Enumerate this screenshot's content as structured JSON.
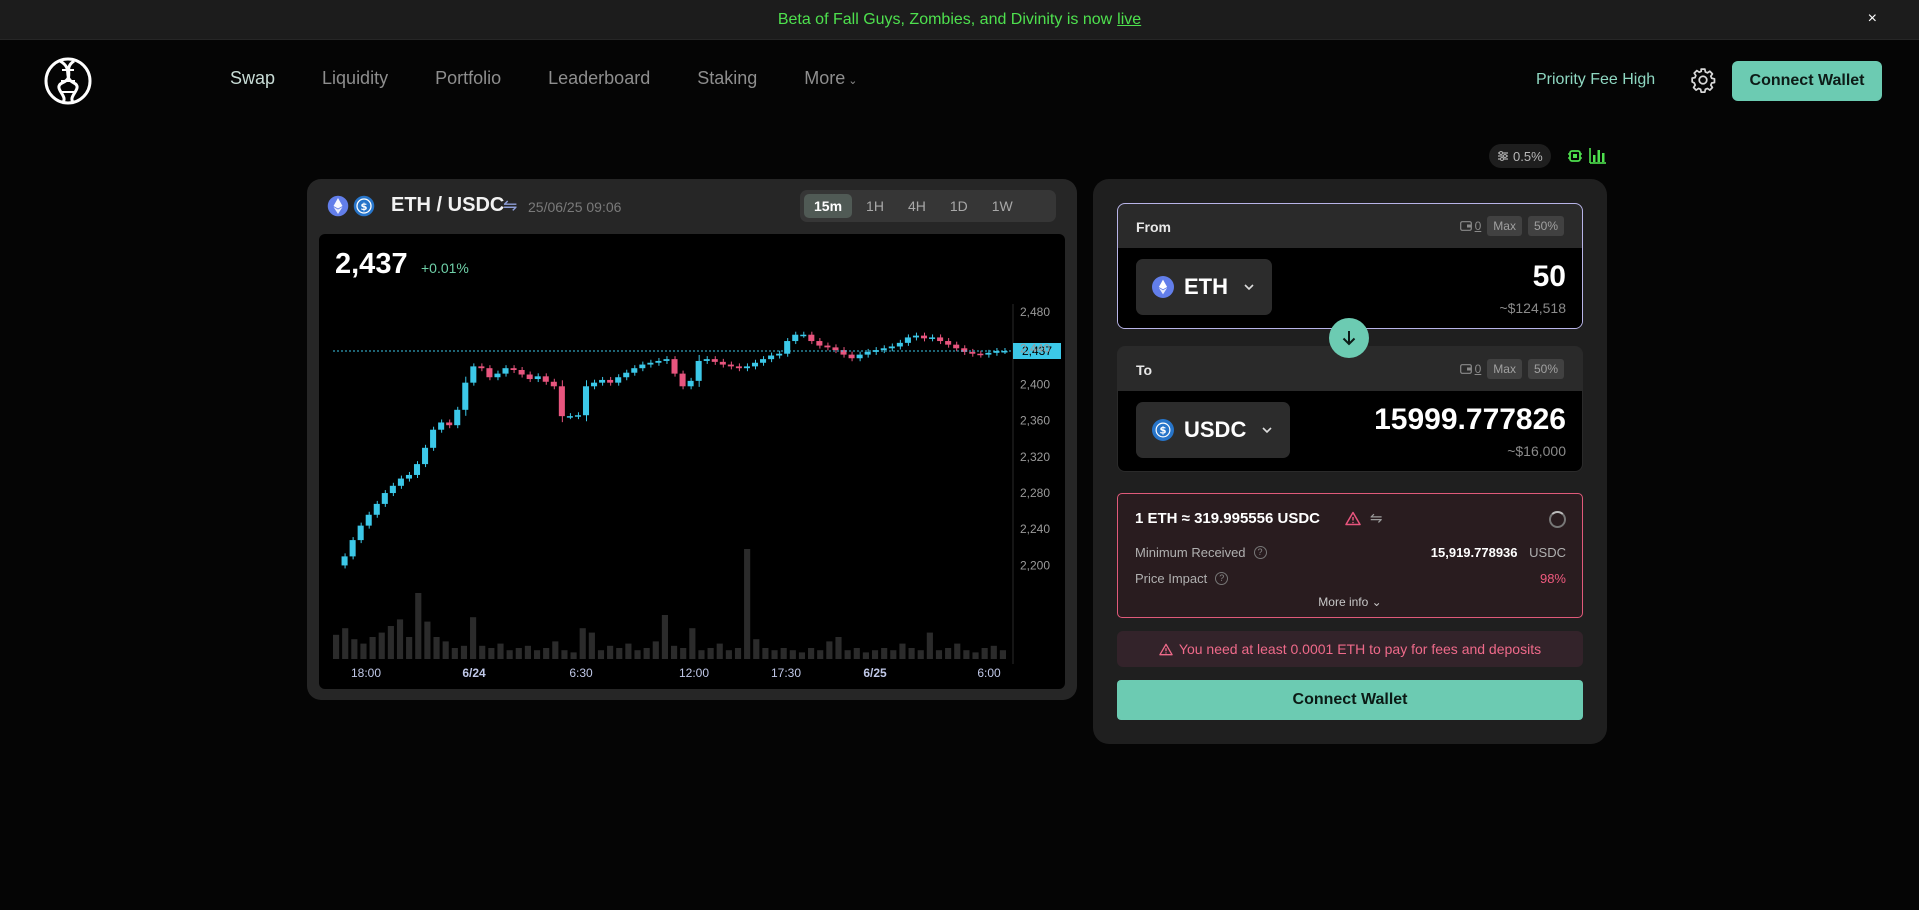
{
  "banner": {
    "text": "Beta of Fall Guys, Zombies, and Divinity is now",
    "link": "live",
    "close": "×"
  },
  "nav": {
    "items": [
      {
        "label": "Swap",
        "active": true
      },
      {
        "label": "Liquidity"
      },
      {
        "label": "Portfolio"
      },
      {
        "label": "Leaderboard"
      },
      {
        "label": "Staking"
      },
      {
        "label": "More"
      }
    ],
    "more_caret": "⌄",
    "priority_fee": "Priority Fee High",
    "connect": "Connect Wallet",
    "settings_icon": "gear-icon"
  },
  "slippage": {
    "value": "0.5%"
  },
  "chart": {
    "pair": "ETH / USDC",
    "swap_glyph": "⇋",
    "datetime": "25/06/25 09:06",
    "timeframes": [
      "15m",
      "1H",
      "4H",
      "1D",
      "1W"
    ],
    "active_timeframe": "15m",
    "last_price": "2,437",
    "change": "+0.01%",
    "price_tag": "2,437"
  },
  "chart_data": {
    "type": "candlestick",
    "y_ticks": [
      "2,480",
      "2,440",
      "2,400",
      "2,360",
      "2,320",
      "2,280",
      "2,240",
      "2,200"
    ],
    "x_ticks": [
      "18:00",
      "6/24",
      "6:30",
      "12:00",
      "17:30",
      "6/25",
      "6:00"
    ],
    "current_price": 2437,
    "ylim": [
      2185,
      2500
    ],
    "up_color": "#3cc8e8",
    "down_color": "#e8557e",
    "closes": [
      2200,
      2210,
      2228,
      2244,
      2256,
      2268,
      2280,
      2288,
      2296,
      2300,
      2312,
      2330,
      2350,
      2358,
      2355,
      2372,
      2402,
      2420,
      2418,
      2408,
      2412,
      2418,
      2416,
      2411,
      2406,
      2409,
      2403,
      2398,
      2365,
      2365,
      2366,
      2398,
      2402,
      2405,
      2402,
      2408,
      2413,
      2418,
      2422,
      2424,
      2426,
      2428,
      2412,
      2398,
      2404,
      2426,
      2428,
      2425,
      2422,
      2420,
      2418,
      2420,
      2424,
      2428,
      2432,
      2434,
      2448,
      2455,
      2455,
      2448,
      2443,
      2441,
      2438,
      2433,
      2429,
      2433,
      2436,
      2438,
      2440,
      2442,
      2446,
      2452,
      2454,
      2451,
      2452,
      2448,
      2444,
      2440,
      2436,
      2434,
      2433,
      2435,
      2437,
      2437
    ],
    "volumes": [
      22,
      28,
      18,
      14,
      20,
      24,
      30,
      36,
      20,
      60,
      34,
      20,
      16,
      10,
      12,
      38,
      12,
      10,
      14,
      8,
      10,
      12,
      8,
      10,
      16,
      8,
      6,
      28,
      24,
      8,
      12,
      10,
      14,
      8,
      10,
      16,
      40,
      12,
      10,
      28,
      8,
      10,
      14,
      8,
      10,
      100,
      18,
      10,
      8,
      10,
      8,
      6,
      10,
      8,
      16,
      20,
      8,
      10,
      6,
      8,
      10,
      8,
      14,
      10,
      8,
      24,
      8,
      10,
      14,
      8,
      6,
      10,
      12,
      8
    ]
  },
  "swap": {
    "from": {
      "label": "From",
      "balance": "0",
      "max": "Max",
      "half": "50%",
      "token": "ETH",
      "amount": "50",
      "usd": "~$124,518"
    },
    "to": {
      "label": "To",
      "balance": "0",
      "max": "Max",
      "half": "50%",
      "token": "USDC",
      "amount": "15999.777826",
      "usd": "~$16,000"
    },
    "quote": {
      "rate": "1 ETH ≈ 319.995556 USDC",
      "min_received_label": "Minimum Received",
      "min_received_value": "15,919.778936",
      "min_received_unit": "USDC",
      "price_impact_label": "Price Impact",
      "price_impact_value": "98%",
      "more_info": "More info"
    },
    "notice": "You need at least 0.0001 ETH to pay for fees and deposits",
    "connect": "Connect Wallet"
  },
  "colors": {
    "accent": "#6ccbb2",
    "banner_text": "#4ee04e",
    "error": "#e05a7a",
    "eth_blue": "#627eea",
    "usdc_blue": "#2775ca"
  }
}
